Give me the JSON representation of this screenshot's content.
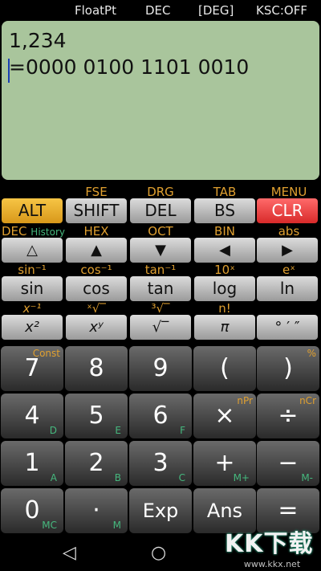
{
  "status": {
    "mode": "FloatPt",
    "base": "DEC",
    "angle": "[DEG]",
    "ksc": "KSC:OFF"
  },
  "display": {
    "input": "1,234",
    "result": "=0000 0100 1101 0010"
  },
  "row1_labels": [
    "",
    "FSE",
    "DRG",
    "TAB",
    "MENU"
  ],
  "row1_keys": [
    "ALT",
    "SHIFT",
    "DEL",
    "BS",
    "CLR"
  ],
  "row2_labels": [
    "DEC",
    "HEX",
    "OCT",
    "BIN",
    "abs"
  ],
  "row2_history": "History",
  "row2_keys": [
    "△",
    "▲",
    "▼",
    "◀",
    "▶"
  ],
  "row3_labels": [
    "sin⁻¹",
    "cos⁻¹",
    "tan⁻¹",
    "10ˣ",
    "eˣ"
  ],
  "row3_keys": [
    "sin",
    "cos",
    "tan",
    "log",
    "ln"
  ],
  "row4_labels": [
    "x⁻¹",
    "ˣ√‾",
    "³√‾",
    "n!",
    ""
  ],
  "row4_keys": [
    "x²",
    "xʸ",
    "√‾",
    "π",
    "° ′ ″"
  ],
  "num_rows": [
    [
      {
        "main": "7",
        "top": "Const",
        "bottom": ""
      },
      {
        "main": "8",
        "top": "",
        "bottom": ""
      },
      {
        "main": "9",
        "top": "",
        "bottom": ""
      },
      {
        "main": "(",
        "top": "",
        "bottom": ""
      },
      {
        "main": ")",
        "top": "%",
        "bottom": ""
      }
    ],
    [
      {
        "main": "4",
        "top": "",
        "bottom": "D"
      },
      {
        "main": "5",
        "top": "",
        "bottom": "E"
      },
      {
        "main": "6",
        "top": "",
        "bottom": "F"
      },
      {
        "main": "×",
        "top": "nPr",
        "bottom": ""
      },
      {
        "main": "÷",
        "top": "nCr",
        "bottom": ""
      }
    ],
    [
      {
        "main": "1",
        "top": "",
        "bottom": "A"
      },
      {
        "main": "2",
        "top": "",
        "bottom": "B"
      },
      {
        "main": "3",
        "top": "",
        "bottom": "C"
      },
      {
        "main": "+",
        "top": "",
        "bottom": "M+"
      },
      {
        "main": "−",
        "top": "",
        "bottom": "M-"
      }
    ],
    [
      {
        "main": "0",
        "top": "",
        "bottom": "MC"
      },
      {
        "main": "·",
        "top": "",
        "bottom": "M"
      },
      {
        "main": "Exp",
        "top": "",
        "bottom": ""
      },
      {
        "main": "Ans",
        "top": "",
        "bottom": ""
      },
      {
        "main": "=",
        "top": "",
        "bottom": ""
      }
    ]
  ],
  "navbar": {
    "back": "◁",
    "home": "○"
  },
  "watermark": {
    "mark": "KK下载",
    "url": "www.kkx.net"
  }
}
